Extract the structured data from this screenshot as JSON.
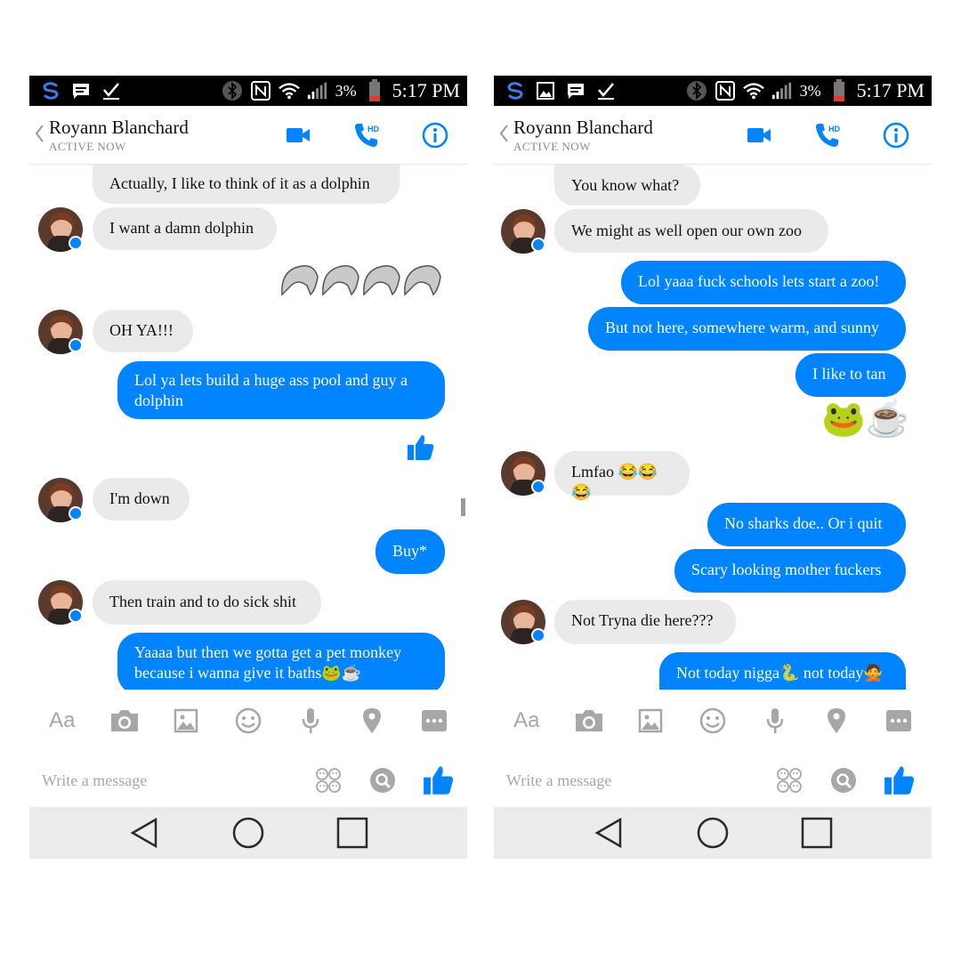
{
  "screens": [
    {
      "status_bar": {
        "battery": "3%",
        "time": "5:17 PM"
      },
      "header": {
        "name": "Royann Blanchard",
        "status": "ACTIVE NOW"
      },
      "messages": [
        "Actually, I like to think of it as a dolphin",
        "I want a damn dolphin",
        "OH YA!!!",
        "Lol ya lets build a huge ass pool and guy a dolphin",
        "I'm down",
        "Buy*",
        "Then train and to do sick shit",
        "Yaaaa but then we gotta get a pet monkey because i wanna give it baths🐸☕"
      ],
      "sticker": "🐬🐬🐬🐬",
      "composer": {
        "aa": "Aa",
        "placeholder": "Write a message"
      }
    },
    {
      "status_bar": {
        "battery": "3%",
        "time": "5:17 PM"
      },
      "header": {
        "name": "Royann Blanchard",
        "status": "ACTIVE NOW"
      },
      "messages": [
        "You know what?",
        "We might as well open our own zoo",
        "Lol yaaa fuck schools lets start a zoo!",
        "But not here, somewhere warm, and sunny",
        "I like to tan",
        "Lmfao 😂😂😂",
        "No sharks doe.. Or i quit",
        "Scary looking mother fuckers",
        "Not Tryna die here???",
        "Not today nigga🐍 not today🙅"
      ],
      "sticker": "🐸☕",
      "composer": {
        "aa": "Aa",
        "placeholder": "Write a message"
      }
    }
  ],
  "colors": {
    "accent": "#0084ff",
    "incoming_bubble": "#eaeaea",
    "status_bar": "#000000",
    "nav_bar": "#ececec"
  }
}
